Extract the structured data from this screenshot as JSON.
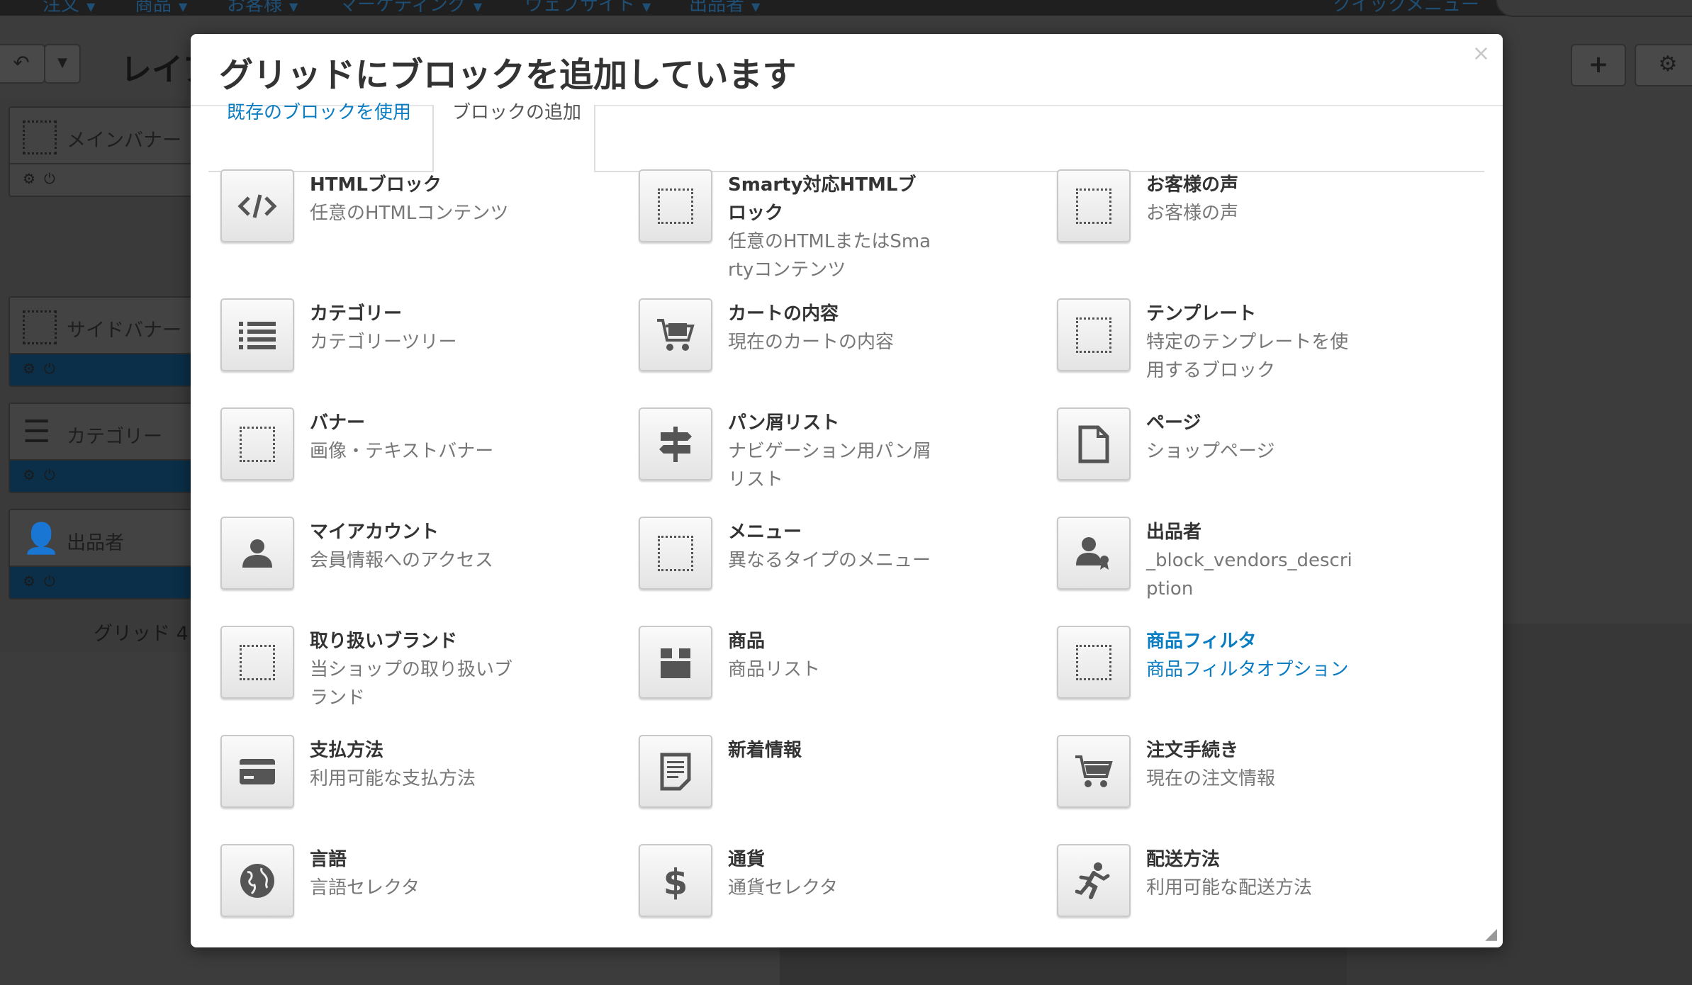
{
  "background": {
    "nav_items": [
      "注文",
      "商品",
      "お客様",
      "マーケティング",
      "ウェブサイト",
      "出品者"
    ],
    "quick_menu": "クイックメニュー",
    "heading": "レイア",
    "grid_blocks": [
      {
        "label": "メインバナー",
        "icon": "placeholder-icon"
      },
      {
        "label": "サイドバナー",
        "icon": "placeholder-icon"
      },
      {
        "label": "カテゴリー",
        "icon": "list-icon"
      },
      {
        "label": "出品者",
        "icon": "vendor-icon"
      }
    ],
    "grid_label": "グリッド 4"
  },
  "modal": {
    "title": "グリッドにブロックを追加しています",
    "close": "×",
    "tabs": [
      {
        "label": "既存のブロックを使用",
        "active": false
      },
      {
        "label": "ブロックの追加",
        "active": true
      }
    ],
    "blocks": [
      {
        "title": "HTMLブロック",
        "desc": "任意のHTMLコンテンツ",
        "icon": "code-icon"
      },
      {
        "title": "Smarty対応HTMLブロック",
        "desc": "任意のHTMLまたはSmartyコンテンツ",
        "icon": "placeholder-icon"
      },
      {
        "title": "お客様の声",
        "desc": "お客様の声",
        "icon": "placeholder-icon"
      },
      {
        "title": "カテゴリー",
        "desc": "カテゴリーツリー",
        "icon": "list-icon"
      },
      {
        "title": "カートの内容",
        "desc": "現在のカートの内容",
        "icon": "cart-full-icon"
      },
      {
        "title": "テンプレート",
        "desc": "特定のテンプレートを使用するブロック",
        "icon": "placeholder-icon"
      },
      {
        "title": "バナー",
        "desc": "画像・テキストバナー",
        "icon": "placeholder-icon"
      },
      {
        "title": "パン屑リスト",
        "desc": "ナビゲーション用パン屑リスト",
        "icon": "signpost-icon"
      },
      {
        "title": "ページ",
        "desc": "ショップページ",
        "icon": "page-icon"
      },
      {
        "title": "マイアカウント",
        "desc": "会員情報へのアクセス",
        "icon": "user-icon"
      },
      {
        "title": "メニュー",
        "desc": "異なるタイプのメニュー",
        "icon": "placeholder-icon"
      },
      {
        "title": "出品者",
        "desc": "_block_vendors_description",
        "icon": "vendor-icon"
      },
      {
        "title": "取り扱いブランド",
        "desc": "当ショップの取り扱いブランド",
        "icon": "placeholder-icon"
      },
      {
        "title": "商品",
        "desc": "商品リスト",
        "icon": "box-icon"
      },
      {
        "title": "商品フィルタ",
        "desc": "商品フィルタオプション",
        "icon": "placeholder-icon",
        "highlighted": true
      },
      {
        "title": "支払方法",
        "desc": "利用可能な支払方法",
        "icon": "credit-card-icon"
      },
      {
        "title": "新着情報",
        "desc": "",
        "icon": "news-icon"
      },
      {
        "title": "注文手続き",
        "desc": "現在の注文情報",
        "icon": "cart-icon"
      },
      {
        "title": "言語",
        "desc": "言語セレクタ",
        "icon": "globe-icon"
      },
      {
        "title": "通貨",
        "desc": "通貨セレクタ",
        "icon": "dollar-icon"
      },
      {
        "title": "配送方法",
        "desc": "利用可能な配送方法",
        "icon": "runner-icon"
      }
    ]
  }
}
